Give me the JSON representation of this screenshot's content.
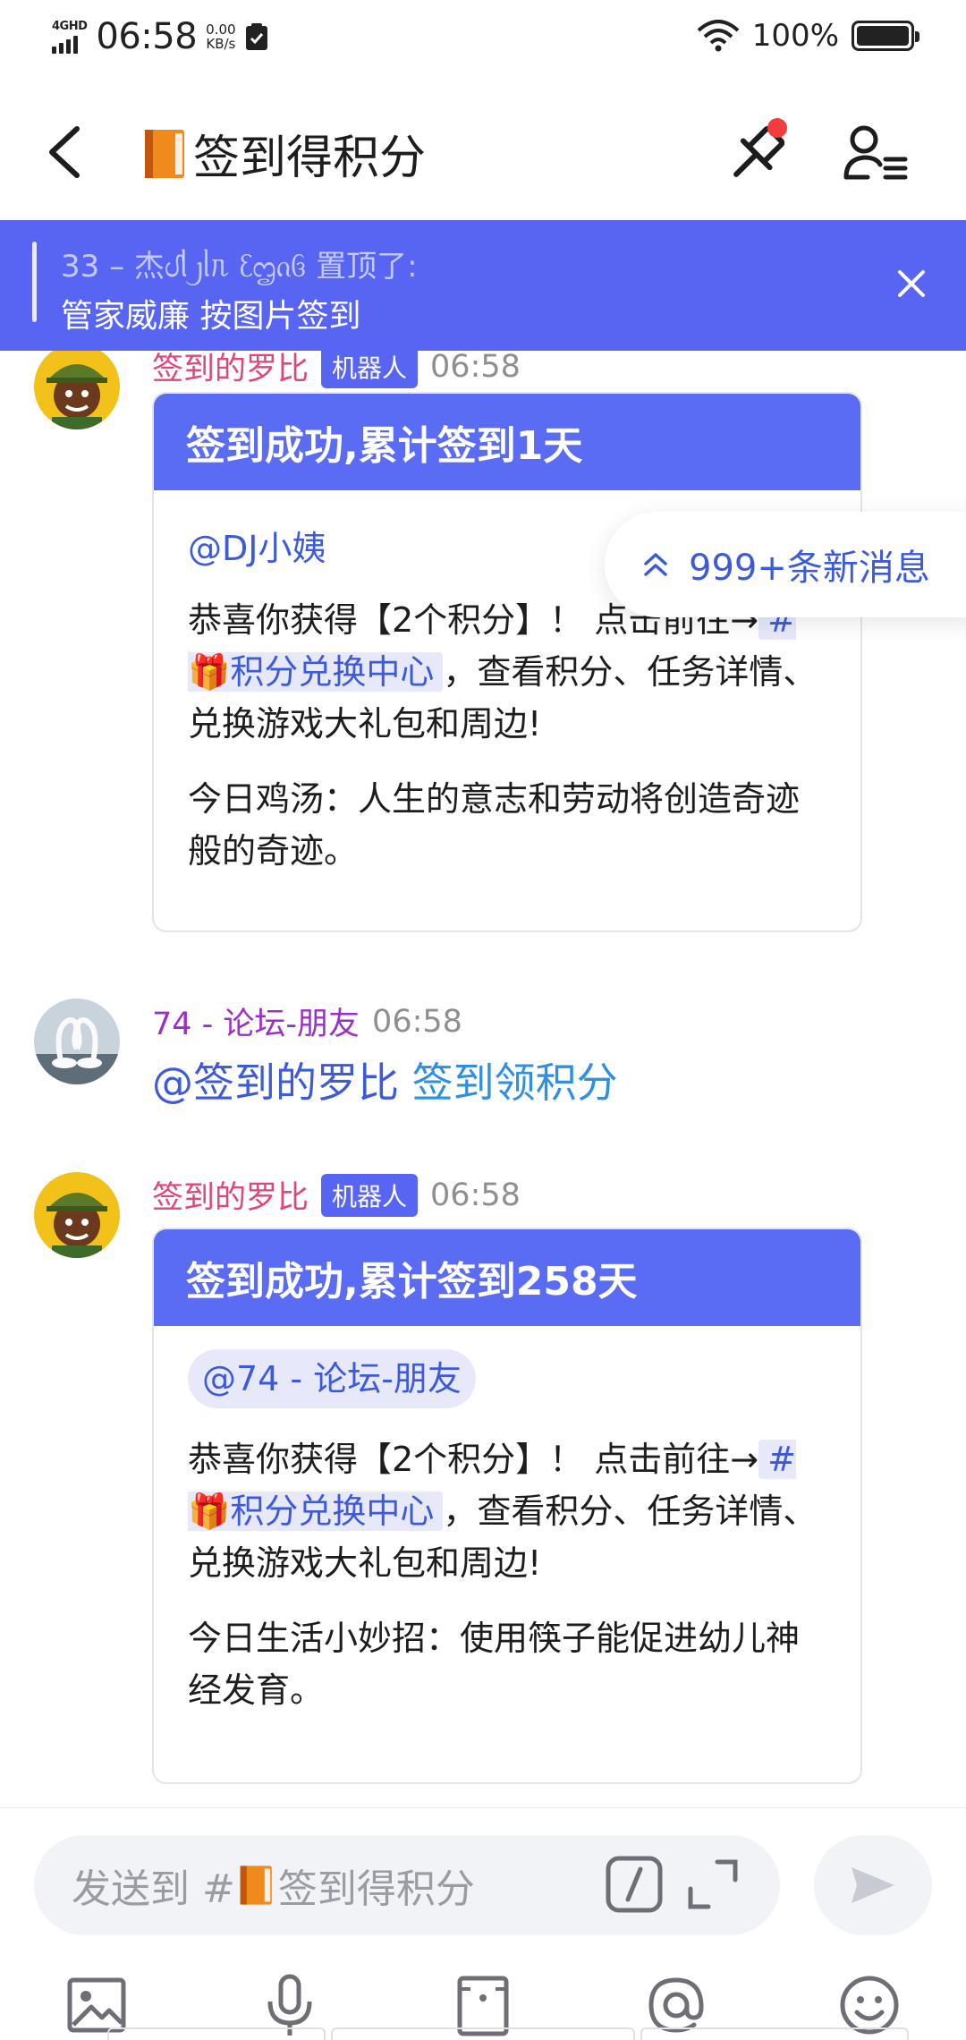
{
  "status_bar": {
    "network": "4GHD",
    "time": "06:58",
    "speed_value": "0.00",
    "speed_unit": "KB/s",
    "battery": "100%"
  },
  "header": {
    "title": "签到得积分",
    "title_icon": "orange-book-icon"
  },
  "pinned_banner": {
    "line1": "33 – 杰ᦔᥣ᧒ᥣᥰ ᦷᦗᦵᦑ 置顶了:",
    "line2": "管家威廉  按图片签到"
  },
  "new_messages": {
    "label": "999+条新消息"
  },
  "messages": [
    {
      "author": "签到的罗比",
      "badge": "机器人",
      "time": "06:58",
      "card_title": "签到成功,累计签到1天",
      "mention": "@DJ小姨",
      "p1_pre": "恭喜你获得【2个积分】！ 点击前往→",
      "channel_link": "#🎁积分兑换中心",
      "p1_post": "，查看积分、任务详情、兑换游戏大礼包和周边!",
      "p2": "今日鸡汤：人生的意志和劳动将创造奇迹般的奇迹。"
    },
    {
      "author": "74 - 论坛-朋友",
      "time": "06:58",
      "mention": "@签到的罗比",
      "text": "签到领积分"
    },
    {
      "author": "签到的罗比",
      "badge": "机器人",
      "time": "06:58",
      "card_title": "签到成功,累计签到258天",
      "mention": "@74 - 论坛-朋友",
      "p1_pre": "恭喜你获得【2个积分】！ 点击前往→",
      "channel_link": "#🎁积分兑换中心",
      "p1_post": "，查看积分、任务详情、兑换游戏大礼包和周边!",
      "p2": "今日生活小妙招：使用筷子能促进幼儿神经发育。"
    }
  ],
  "composer": {
    "placeholder_prefix": "发送到 #",
    "placeholder_channel": "签到得积分"
  },
  "colors": {
    "accent": "#5865f2",
    "bot_name": "#e0457b",
    "user_name": "#9b30c8",
    "link": "#3d5bd9"
  }
}
